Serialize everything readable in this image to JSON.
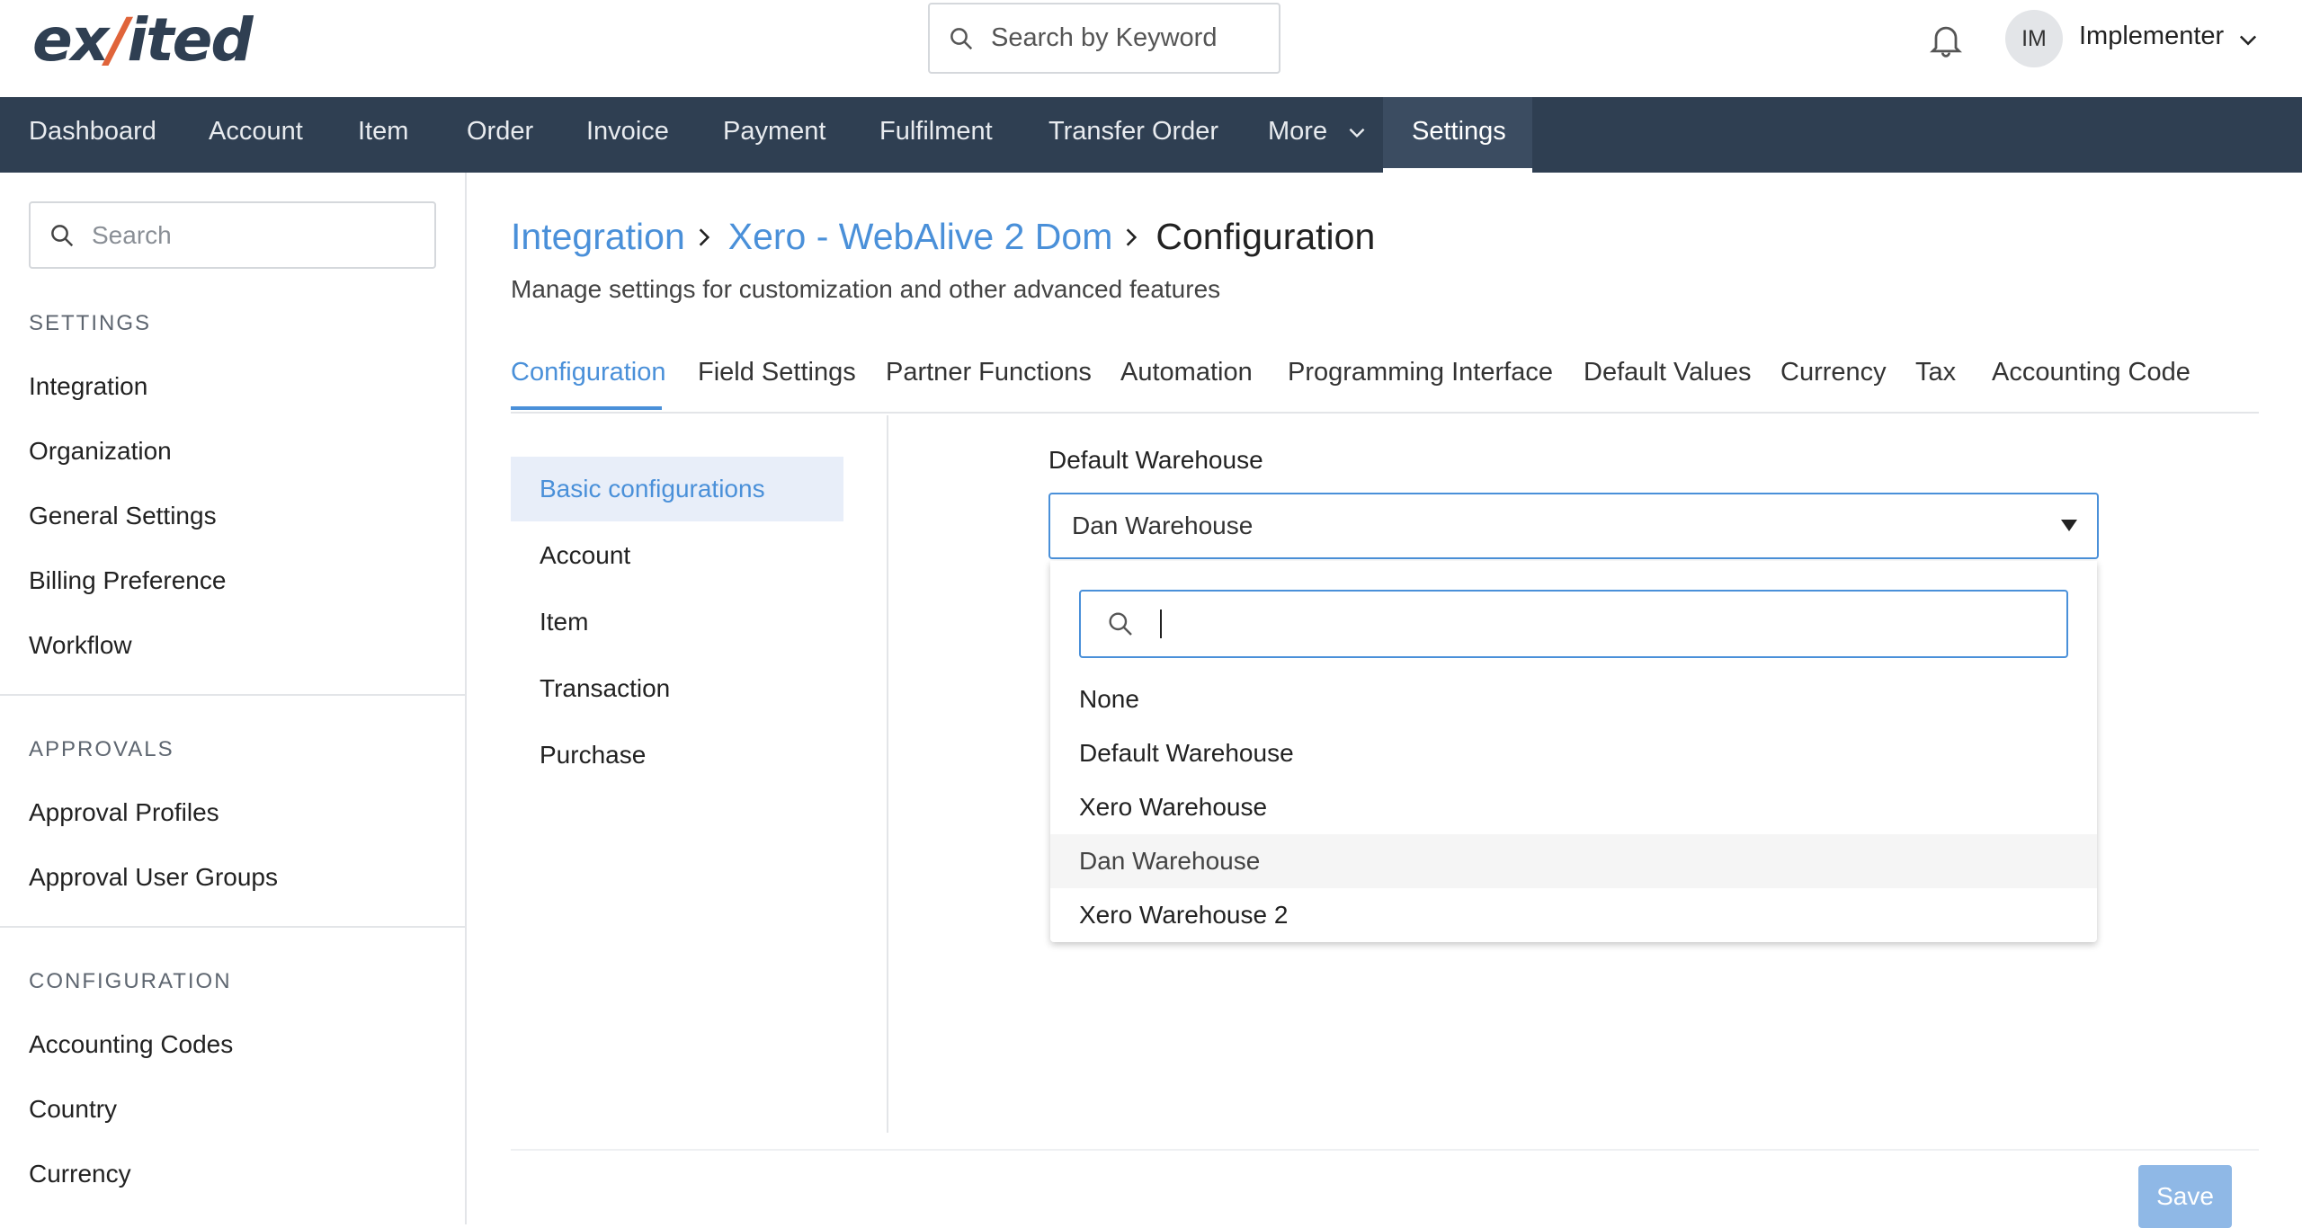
{
  "header": {
    "logo": {
      "part1": "ex",
      "accent": "/",
      "part2": "ited"
    },
    "search_placeholder": "Search by Keyword",
    "avatar_initials": "IM",
    "user_name": "Implementer"
  },
  "nav": {
    "items": [
      "Dashboard",
      "Account",
      "Item",
      "Order",
      "Invoice",
      "Payment",
      "Fulfilment",
      "Transfer Order",
      "More",
      "Settings"
    ],
    "active": "Settings"
  },
  "sidebar": {
    "search_placeholder": "Search",
    "sections": [
      {
        "heading": "SETTINGS",
        "items": [
          "Integration",
          "Organization",
          "General Settings",
          "Billing Preference",
          "Workflow"
        ]
      },
      {
        "heading": "APPROVALS",
        "items": [
          "Approval Profiles",
          "Approval User Groups"
        ]
      },
      {
        "heading": "CONFIGURATION",
        "items": [
          "Accounting Codes",
          "Country",
          "Currency"
        ]
      }
    ]
  },
  "breadcrumb": [
    "Integration",
    "Xero - WebAlive 2 Dom",
    "Configuration"
  ],
  "subtitle": "Manage settings for customization and other advanced features",
  "tabs": {
    "items": [
      "Configuration",
      "Field Settings",
      "Partner Functions",
      "Automation",
      "Programming Interface",
      "Default Values",
      "Currency",
      "Tax",
      "Accounting Code"
    ],
    "active": "Configuration"
  },
  "subnav": {
    "items": [
      "Basic configurations",
      "Account",
      "Item",
      "Transaction",
      "Purchase"
    ],
    "active": "Basic configurations"
  },
  "form": {
    "default_warehouse": {
      "label": "Default Warehouse",
      "value": "Dan Warehouse",
      "search_value": "",
      "options": [
        "None",
        "Default Warehouse",
        "Xero Warehouse",
        "Dan Warehouse",
        "Xero Warehouse 2"
      ]
    }
  },
  "save_label": "Save",
  "colors": {
    "nav_bg": "#2f3f52",
    "accent": "#4a90d9",
    "logo_accent": "#e0643a",
    "save_bg": "#8fb8e6"
  }
}
